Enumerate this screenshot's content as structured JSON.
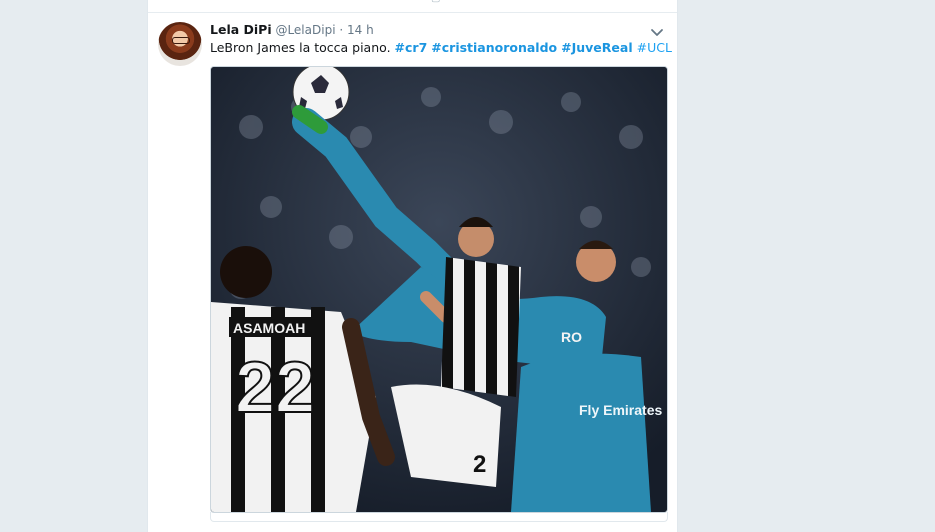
{
  "tweet": {
    "name": "Lela DiPi",
    "handle": "@LelaDipi",
    "separator": "·",
    "time": "14 h",
    "text": "LeBron James la tocca piano.",
    "hashtags": [
      {
        "text": "#cr7",
        "bold": true
      },
      {
        "text": "#cristianoronaldo",
        "bold": true
      },
      {
        "text": "#JuveReal",
        "bold": true
      },
      {
        "text": "#UCL",
        "bold": false
      }
    ]
  },
  "media": {
    "jersey_name": "ASAMOAH",
    "jersey_number": "22",
    "shorts_number": "2",
    "sponsor_text": "Fly Emirates",
    "chest_letters": "RO"
  },
  "icons": {
    "menu": "chevron-down-icon",
    "avatar": "avatar",
    "previous_actions": [
      "reply-icon",
      "retweet-icon",
      "like-icon",
      "message-icon"
    ]
  },
  "colors": {
    "link": "#1da1f2",
    "background": "#e6ecf0",
    "juve_stripe": "#111111",
    "real_kit": "#2a8ab0"
  }
}
